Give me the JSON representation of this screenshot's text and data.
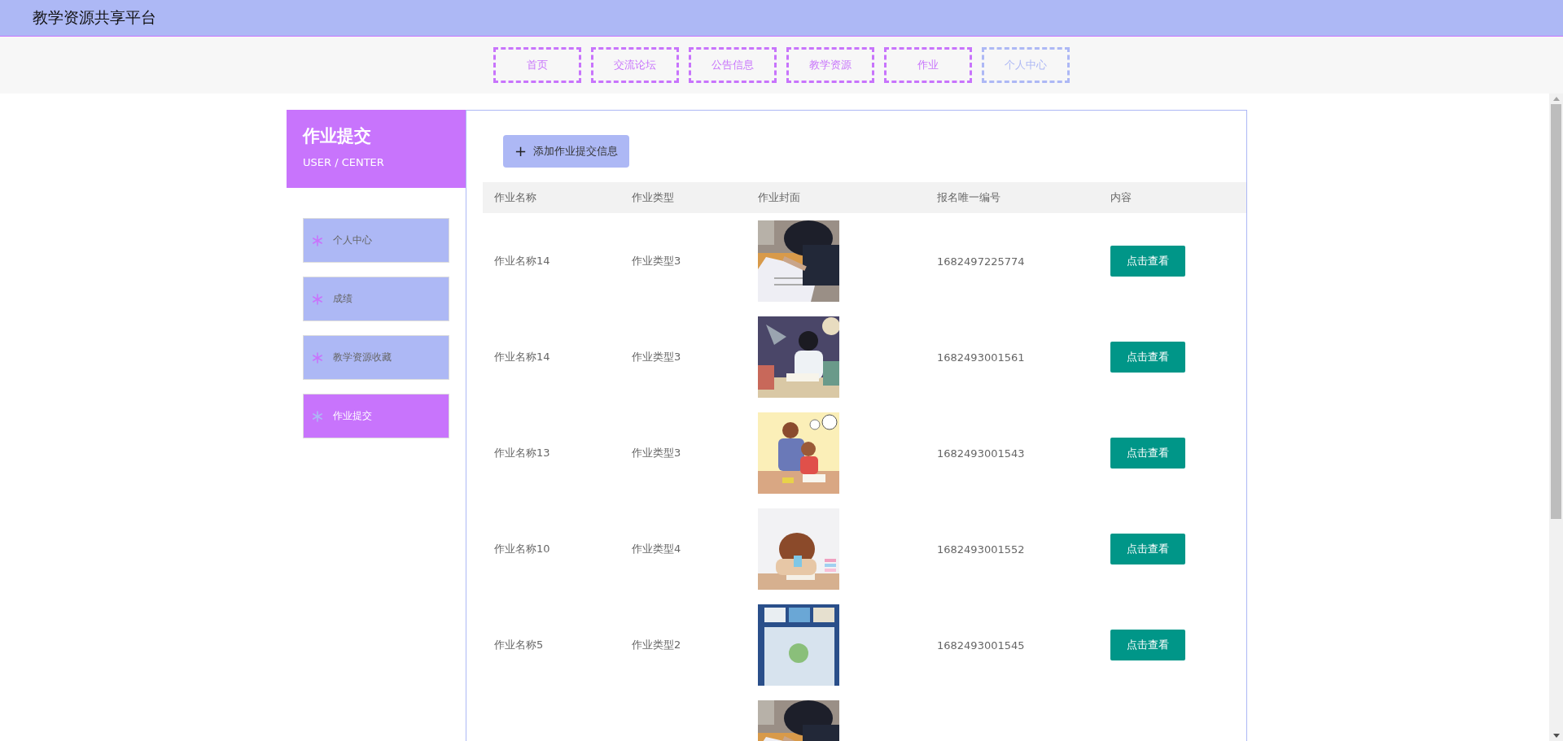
{
  "header": {
    "title": "教学资源共享平台"
  },
  "nav": [
    {
      "label": "首页",
      "selected": false
    },
    {
      "label": "交流论坛",
      "selected": false
    },
    {
      "label": "公告信息",
      "selected": false
    },
    {
      "label": "教学资源",
      "selected": false
    },
    {
      "label": "作业",
      "selected": false
    },
    {
      "label": "个人中心",
      "selected": true
    }
  ],
  "sidebar": {
    "title": "作业提交",
    "subtitle": "USER / CENTER",
    "items": [
      {
        "label": "个人中心",
        "selected": false
      },
      {
        "label": "成绩",
        "selected": false
      },
      {
        "label": "教学资源收藏",
        "selected": false
      },
      {
        "label": "作业提交",
        "selected": true
      }
    ]
  },
  "add_button": {
    "icon": "+",
    "label": "添加作业提交信息"
  },
  "table": {
    "columns": [
      "作业名称",
      "作业类型",
      "作业封面",
      "报名唯一编号",
      "内容"
    ],
    "rows": [
      {
        "name": "作业名称14",
        "type": "作业类型3",
        "cover": {
          "kind": "picture"
        },
        "number": "1682497225774",
        "action": "点击查看"
      },
      {
        "name": "作业名称14",
        "type": "作业类型3",
        "cover": {
          "kind": "picture"
        },
        "number": "1682493001561",
        "action": "点击查看"
      },
      {
        "name": "作业名称13",
        "type": "作业类型3",
        "cover": {
          "kind": "picture"
        },
        "number": "1682493001543",
        "action": "点击查看"
      },
      {
        "name": "作业名称10",
        "type": "作业类型4",
        "cover": {
          "kind": "picture"
        },
        "number": "1682493001552",
        "action": "点击查看"
      },
      {
        "name": "作业名称5",
        "type": "作业类型2",
        "cover": {
          "kind": "picture"
        },
        "number": "1682493001545",
        "action": "点击查看"
      },
      {
        "cover": {
          "kind": "picture"
        }
      }
    ]
  }
}
